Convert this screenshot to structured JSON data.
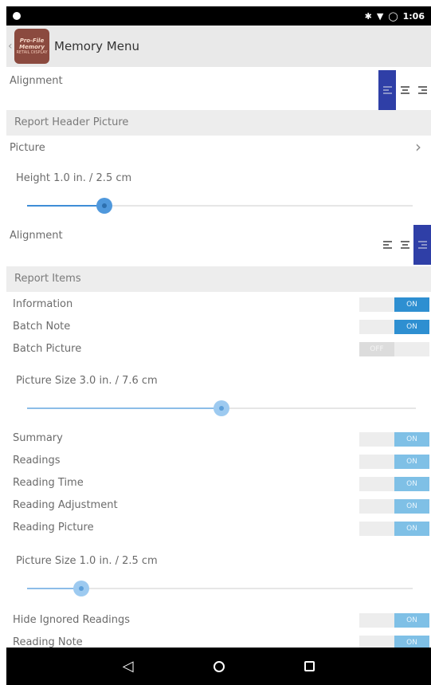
{
  "status_bar": {
    "time": "1:06"
  },
  "app_bar": {
    "title": "Memory Menu",
    "logo_line1": "Pro-File",
    "logo_line2": "Memory",
    "logo_caption": "RETAIL DISPLAY"
  },
  "header_alignment": {
    "label": "Alignment",
    "selected": "left"
  },
  "section_header_picture": {
    "label": "Report Header Picture"
  },
  "picture_row": {
    "label": "Picture"
  },
  "height_slider": {
    "label": "Height 1.0 in. / 2.5 cm",
    "fraction": 0.2
  },
  "picture_alignment": {
    "label": "Alignment",
    "selected": "right"
  },
  "section_report_items": {
    "label": "Report Items"
  },
  "toggles_top": [
    {
      "label": "Information",
      "state": "ON"
    },
    {
      "label": "Batch Note",
      "state": "ON"
    },
    {
      "label": "Batch Picture",
      "state": "OFF"
    }
  ],
  "picture_size_slider_1": {
    "label": "Picture Size 3.0 in. / 7.6 cm",
    "fraction": 0.5
  },
  "toggles_mid": [
    {
      "label": "Summary",
      "state": "ON"
    },
    {
      "label": "Readings",
      "state": "ON"
    },
    {
      "label": "Reading Time",
      "state": "ON"
    },
    {
      "label": "Reading Adjustment",
      "state": "ON"
    },
    {
      "label": "Reading Picture",
      "state": "ON"
    }
  ],
  "picture_size_slider_2": {
    "label": "Picture Size 1.0 in. / 2.5 cm",
    "fraction": 0.14
  },
  "toggles_bottom": [
    {
      "label": "Hide Ignored Readings",
      "state": "ON"
    },
    {
      "label": "Reading Note",
      "state": "ON"
    }
  ],
  "colors": {
    "accent": "#2f3fa7",
    "toggle_on": "#2e8fd1",
    "slider": "#4f98dc"
  }
}
